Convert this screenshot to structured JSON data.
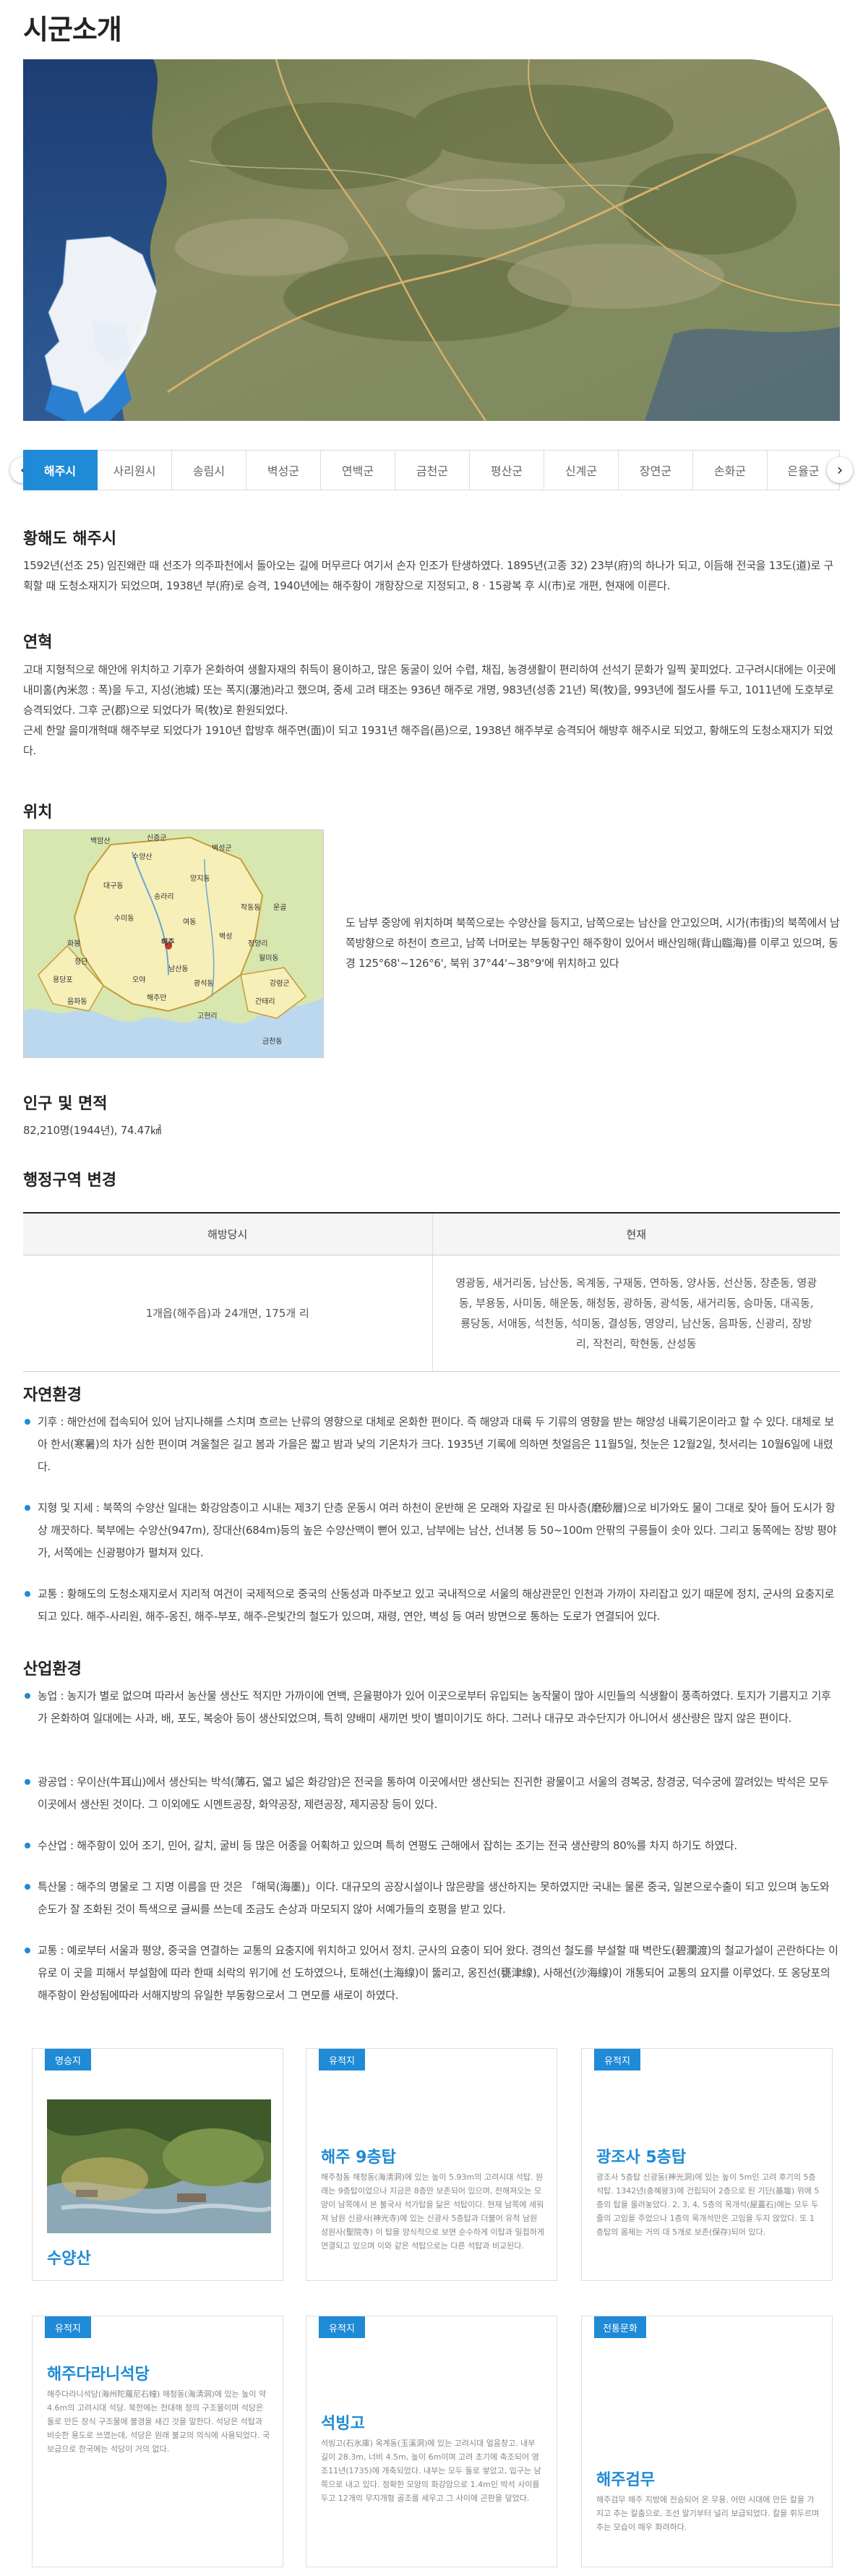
{
  "page": {
    "title": "시군소개"
  },
  "tabs": {
    "prev": "‹",
    "next": "›",
    "items": [
      "해주시",
      "사리원시",
      "송림시",
      "벽성군",
      "연백군",
      "금천군",
      "평산군",
      "신계군",
      "장연군",
      "손화군",
      "은율군"
    ]
  },
  "sections": {
    "s1": {
      "title": "황해도 해주시",
      "text": "1592년(선조 25) 임진왜란 때 선조가 의주파천에서 돌아오는 길에 머무르다 여기서 손자 인조가 탄생하였다. 1895년(고종 32) 23부(府)의 하나가 되고, 이듬해 전국을 13도(道)로 구획할 때 도청소재지가 되었으며, 1938년 부(府)로 승격, 1940년에는 해주항이 개항장으로 지정되고, 8 · 15광복 후 시(市)로 개편, 현재에 이른다."
    },
    "s2": {
      "title": "연혁",
      "text": "고대 지형적으로 해안에 위치하고 기후가 온화하여 생활자재의 취득이 용이하고, 많은 동굴이 있어 수렵, 채집, 농경생활이 편리하여 선석기 문화가 일찍 꽃피었다. 고구려시대에는 이곳에 내미홀(內米忽 : 폭)을 두고, 지성(池城) 또는 폭지(瀑池)라고 했으며, 중세 고려 태조는 936년 해주로 개명, 983년(성종 21년) 목(牧)을, 993년에 절도사를 두고, 1011년에 도호부로 승격되었다. 그후 군(郡)으로 되었다가 목(牧)로 환원되었다.\n근세 한말 을미개혁때 해주부로 되었다가 1910년 합방후 해주면(面)이 되고 1931년 해주읍(邑)으로, 1938년 해주부로 승격되어 해방후 해주시로 되었고, 황해도의 도청소재지가 되었다."
    },
    "s3": {
      "title": "위치",
      "text": "도 남부 중앙에 위치하며 북쪽으로는 수양산을 등지고, 남쪽으로는 남산을 안고있으며, 시가(市街)의 북쪽에서 남쪽방향으로 하천이 흐르고, 남쪽 너머로는 부동항구인 해주항이 있어서 배산임해(背山臨海)를 이루고 있으며, 동경 125°68'~126°6', 북위 37°44'~38°9'에 위치하고 있다"
    },
    "s4": {
      "title": "인구 및 면적",
      "text": "82,210명(1944년), 74.47㎢"
    },
    "s5": {
      "title": "행정구역 변경",
      "col1": "해방당시",
      "col2": "현재",
      "row1": "1개읍(해주읍)과 24개면, 175개 리",
      "row2": "영광동, 새거리동, 남산동, 옥계동, 구재동, 연하동, 양사동, 선산동, 장춘동, 영광동, 부용동, 사미동, 해운동, 해청동, 광하동, 광석동, 새거리동, 승마동, 대곡동, 룡당동, 서애동, 석천동, 석미동, 결성동, 영양리, 남산동, 음파동, 신광리, 장방리, 작천리, 학현동, 산성동"
    },
    "s6": {
      "title": "자연환경",
      "b1": "기후 : 해안선에 접속되어 있어 남지나해를 스치며 흐르는 난류의 영향으로 대체로 온화한 편이다. 즉 해양과 대륙 두 기류의 영향을 받는 해양성 내륙기온이라고 할 수 있다. 대체로 보아 한서(寒暑)의 차가 심한 편이며 겨울철은 길고 봄과 가을은 짧고 밤과 낮의 기온차가 크다. 1935년 기록에 의하면 첫얼음은 11월5일, 첫눈은 12월2일, 첫서리는 10월6일에 내렸다.",
      "b2": "지형 및 지세 : 북쪽의 수양산 일대는 화강암층이고 시내는 제3기 단층 운동시 여러 하천이 운반해 온 모래와 자갈로 된 마사층(磨砂層)으로 비가와도 물이 그대로 잦아 들어 도시가 항상 깨끗하다. 북부에는 수양산(947m), 장대산(684m)등의 높은 수양산맥이 뻗어 있고, 남부에는 남산, 선녀봉 등 50~100m 안팎의 구릉들이 솟아 있다. 그리고 동쪽에는 장방 평야가, 서쪽에는 신광평야가 펼쳐져 있다.",
      "b3": "교통 : 황해도의 도청소재지로서 지리적 여건이 국제적으로 중국의 산동성과 마주보고 있고 국내적으로 서울의 해상관문인 인천과 가까이 자리잡고 있기 때문에 정치, 군사의 요충지로 되고 있다. 해주-사리원, 해주-옹진, 해주-부포, 해주-은빛간의 철도가 있으며, 재령, 연안, 벽성 등 여러 방면으로 통하는 도로가 연결되어 있다."
    },
    "s7": {
      "title": "산업환경",
      "b1": "농업 : 농지가 별로 없으며 따라서 농산물 생산도 적지만 가까이에 연백, 은율평야가 있어 이곳으로부터 유입되는 농작물이 많아 시민들의 식생활이 풍족하였다. 토지가 기름지고 기후가 온화하여 일대에는 사과, 배, 포도, 복숭아 등이 생산되었으며, 특히 양배미 새끼먼 밧이 별미이기도 하다. 그러나 대규모 과수단지가 아니어서 생산량은 많지 않은 편이다.",
      "b2": "광공업 : 우이산(牛耳山)에서 생산되는 박석(薄石, 엷고 넓은 화강암)은 전국을 통하여 이곳에서만 생산되는 진귀한 광물이고 서울의 경복궁, 창경궁, 덕수궁에 깔려있는 박석은 모두 이곳에서 생산된 것이다. 그 이외에도 시멘트공장, 화약공장, 제련공장, 제지공장 등이 있다.",
      "b3": "수산업 : 해주항이 있어 조기, 민어, 갈치, 굴비 등 많은 어종을 어획하고 있으며 특히 연평도 근해에서 잡히는 조기는 전국 생산량의 80%를 차지 하기도 하였다.",
      "b4": "특산물 : 해주의 명물로 그 지명 이름을 딴 것은 「해묵(海墨)」이다. 대규모의 공장시설이나 많은량을 생산하지는 못하였지만 국내는 물론 중국, 일본으로수출이 되고 있으며 농도와 순도가 잘 조화된 것이 특색으로 글씨를 쓰는데 조금도 손상과 마모되지 않아 서예가들의 호평을 받고 있다.",
      "b5": "교통 : 예로부터 서울과 평양, 중국을 연결하는 교통의 요충지에 위치하고 있어서 정치. 군사의 요충이 되어 왔다. 경의선 철도를 부설할 때 벽란도(碧瀾渡)의 철교가설이 곤란하다는 이유로 이 곳을 피해서 부설함에 따라 한때 쇠락의 위기에 선 도하였으나, 토해선(土海線)이 뚫리고, 옹진선(甕津線), 사해선(沙海線)이 개통되어 교통의 요지를 이루었다. 또 옹당포의 해주항이 완성됨에따라 서해지방의 유일한 부동항으로서 그 면모를 새로이 하였다."
    }
  },
  "cards": [
    {
      "badge": "명승지",
      "title": "수양산",
      "desc": ""
    },
    {
      "badge": "유적지",
      "title": "해주 9층탑",
      "desc": "해주청동 해청동(海淸洞)에 있는 높이 5.93m의 고려시대 석탑. 원래는 9층탑이었으나 지금은 8층만 보존되어 있으며, 전해져오는 모양이 남쪽에서 본 불국사 석가탑을 닮은 석탑이다. 현재 남쪽에 세워져 남원 신광사(神光寺)에 있는 신광사 5층탑과 더불어 유적 남원 성원사(聖院寺) 이 탑을 양식적으로 보면 순수하게 이탑과 밀접하게 연결되고 있으며 이와 같은 석탑으로는 다른 석탑과 비교된다."
    },
    {
      "badge": "유적지",
      "title": "광조사 5층탑",
      "desc": "광조사 5층탑 신광동(神光洞)에 있는 높이 5m인 고려 후기의 5층 석탑. 1342년(충혜왕3)에 건립되어 2층으로 된 기단(基壇) 위에 5층의 탑을 올려놓았다. 2, 3, 4, 5층의 옥개석(屋蓋石)에는 모두 두 줄의 고임을 주었으나 1층의 옥개석만은 고임을 두지 않았다. 또 1층탑의 몸체는 거의 대 5개로 보존(保存)되어 있다."
    },
    {
      "badge": "유적지",
      "title": "해주다라니석당",
      "desc": "해주다라니석당(海州陀羅尼石幢) 해청동(海淸洞)에 있는 높이 약 4.6m의 고려시대 석당. 북한에는 천대해 정의 구조물이며 석당은 돌로 만든 장식 구조물에 불경을 새긴 것을 말한다. 석당은 석탑과 비슷한 용도로 쓰였는데, 석당은 원래 불교의 의식에 사용되었다. 국보급으로 한국에는 석당이 거의 없다."
    },
    {
      "badge": "유적지",
      "title": "석빙고",
      "desc": "석빙고(石氷庫) 옥계동(玉溪洞)에 있는 고려시대 얼음창고. 내부 길이 28.3m, 너비 4.5m, 높이 6m이며 고려 초기에 축조되어 영조11년(1735)에 개축되었다. 내부는 모두 돌로 쌓았고, 입구는 남쪽으로 내고 있다. 정확한 모양의 화강암으로 1.4m인 박석 사이를 두고 12개의 무지개형 골조를 세우고 그 사이에 곤판을 덮었다."
    },
    {
      "badge": "전통문화",
      "title": "해주검무",
      "desc": "해주검무 해주 지방에 전승되어 온 무용. 어떤 시대에 만든 칼을 가지고 추는 칼춤으로, 조선 말기부터 널리 보급되었다. 칼을 휘두르며 추는 모습이 매우 화려하다."
    }
  ],
  "map_labels": [
    "백암산",
    "신증군",
    "수양산",
    "벽성군",
    "양지동",
    "대구동",
    "송라리",
    "작동동",
    "운골",
    "수미동",
    "여동",
    "해주",
    "벽성",
    "정양리",
    "월미동",
    "화봉",
    "청단",
    "용당포",
    "오야",
    "해주만",
    "남산동",
    "광석동",
    "음파동",
    "강령군",
    "간태리",
    "고현리",
    "금천동"
  ],
  "colors": {
    "accent": "#1f8ad6",
    "text": "#333333"
  }
}
